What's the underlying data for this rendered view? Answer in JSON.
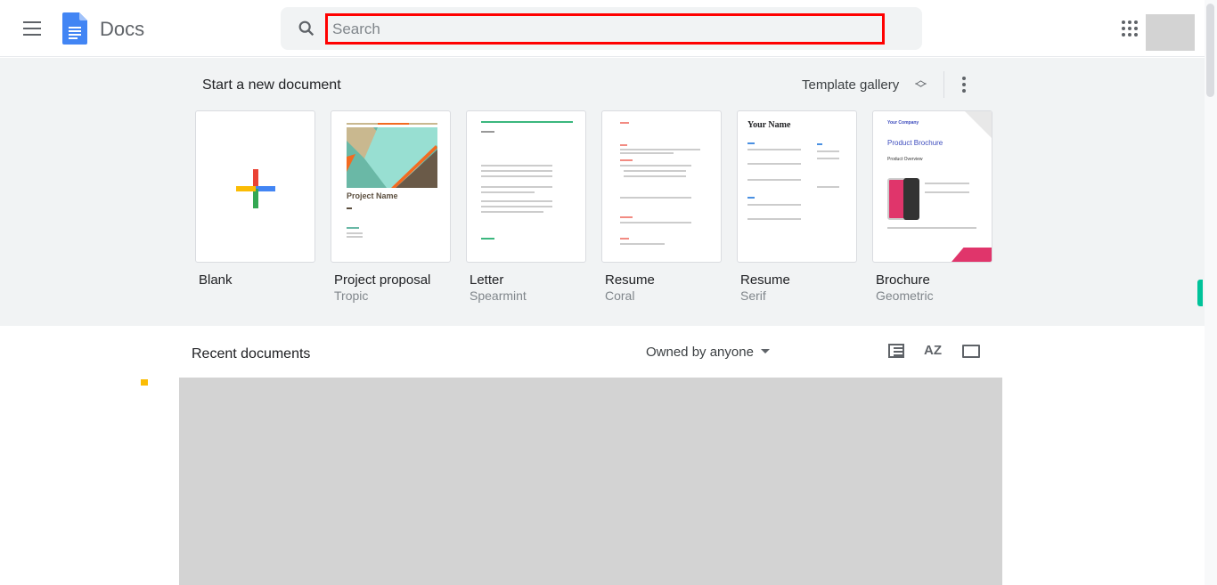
{
  "header": {
    "app_name": "Docs",
    "search_placeholder": "Search",
    "search_value": ""
  },
  "templates": {
    "section_title": "Start a new document",
    "gallery_label": "Template gallery",
    "items": [
      {
        "name": "Blank",
        "subtitle": ""
      },
      {
        "name": "Project proposal",
        "subtitle": "Tropic",
        "thumb_title": "Project Name"
      },
      {
        "name": "Letter",
        "subtitle": "Spearmint"
      },
      {
        "name": "Resume",
        "subtitle": "Coral"
      },
      {
        "name": "Resume",
        "subtitle": "Serif",
        "thumb_title": "Your Name"
      },
      {
        "name": "Brochure",
        "subtitle": "Geometric",
        "thumb_title": "Product Brochure",
        "thumb_company": "Your Company",
        "thumb_section": "Product Overview"
      }
    ]
  },
  "recent": {
    "title": "Recent documents",
    "owner_filter": "Owned by anyone",
    "sort_label": "AZ"
  },
  "colors": {
    "accent_red": "#ff0000",
    "band": "#f1f3f4",
    "docs_blue": "#4285f4"
  }
}
